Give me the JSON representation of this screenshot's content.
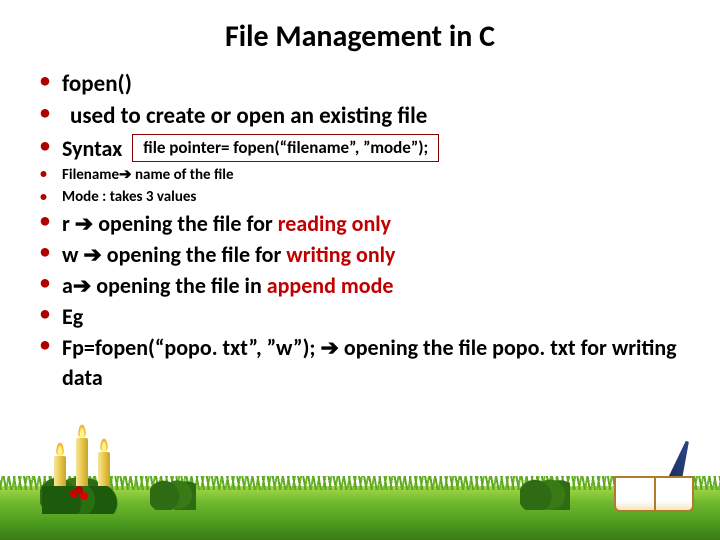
{
  "title": "File Management in C",
  "bullets": {
    "fopen": "fopen()",
    "used": "used to create or open an existing file",
    "syntax_label": "Syntax",
    "syntax_box": "file pointer= fopen(“filename”, ”mode”);",
    "filename_pre": "Filename",
    "filename_post": " name of the file",
    "mode_takes": "Mode : takes 3 values",
    "r_pre": "r ",
    "r_mid": " opening the file for ",
    "r_red": "reading only",
    "w_pre": "w ",
    "w_mid": " opening the file for ",
    "w_red": "writing only",
    "a_pre": "a",
    "a_mid": " opening the file in ",
    "a_red": "append mode",
    "eg": "Eg",
    "fp_pre": "Fp=fopen(“popo. txt”, ”w”); ",
    "fp_post": " opening the file popo. txt for writing data"
  },
  "arrow": "➔"
}
